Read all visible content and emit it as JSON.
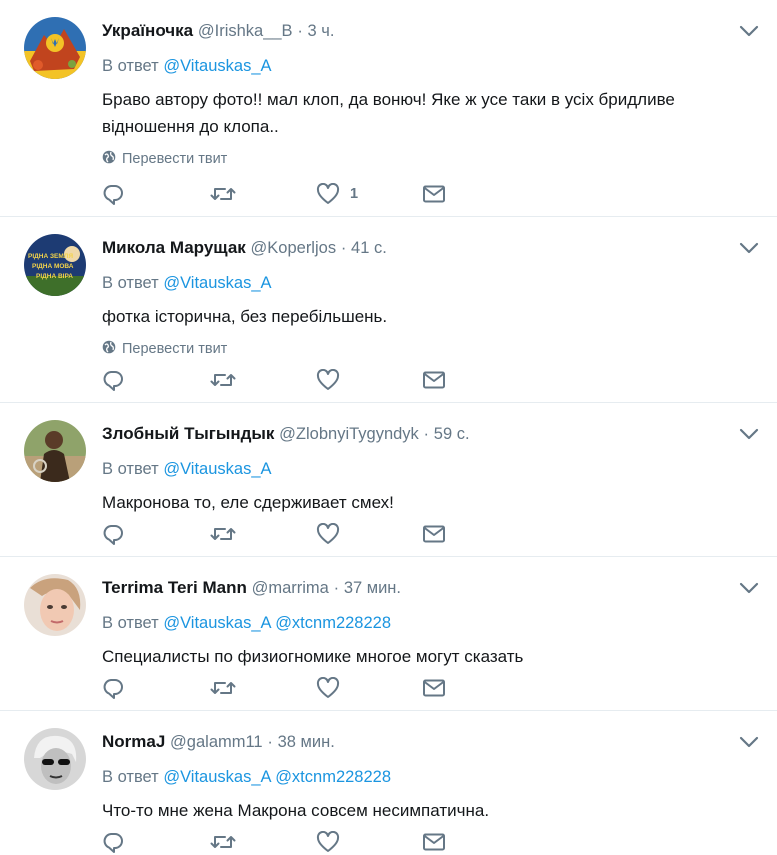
{
  "tweets": [
    {
      "name": "Україночка",
      "handle": "@Irishka__B",
      "sep": "·",
      "time": "3 ч.",
      "reply_prefix": "В ответ",
      "mentions": [
        "@Vitauskas_A"
      ],
      "text": "Браво автору фото!! мал клоп, да вонюч! Яке ж усе таки в усіх бридливе відношення до клопа..",
      "translate": "Перевести твит",
      "like_count": "1"
    },
    {
      "name": "Микола Марущак",
      "handle": "@Koperljos",
      "sep": "·",
      "time": "41 с.",
      "reply_prefix": "В ответ",
      "mentions": [
        "@Vitauskas_A"
      ],
      "text": "фотка історична, без перебільшень.",
      "translate": "Перевести твит",
      "like_count": "",
      "avatar_text": [
        "РІДНА ЗЕМЛЯ",
        "РІДНА МОВА",
        "РІДНА ВІРА"
      ]
    },
    {
      "name": "Злобный Тыгындык",
      "handle": "@ZlobnyiTygyndyk",
      "sep": "·",
      "time": "59 с.",
      "reply_prefix": "В ответ",
      "mentions": [
        "@Vitauskas_A"
      ],
      "text": "Макронова то, еле сдерживает смех!",
      "translate": "",
      "like_count": ""
    },
    {
      "name": "Terrima Teri Mann",
      "handle": "@marrima",
      "sep": "·",
      "time": "37 мин.",
      "reply_prefix": "В ответ",
      "mentions": [
        "@Vitauskas_A",
        "@xtcnm228228"
      ],
      "text": "Специалисты по физиогномике многое могут сказать",
      "translate": "",
      "like_count": ""
    },
    {
      "name": "NormaJ",
      "handle": "@galamm11",
      "sep": "·",
      "time": "38 мин.",
      "reply_prefix": "В ответ",
      "mentions": [
        "@Vitauskas_A",
        "@xtcnm228228"
      ],
      "text": "Что-то мне жена Макрона совсем несимпатична.",
      "translate": "",
      "like_count": ""
    }
  ],
  "icons": {
    "reply": "reply-icon",
    "retweet": "retweet-icon",
    "like": "heart-icon",
    "dm": "envelope-icon",
    "caret": "chevron-down-icon",
    "globe": "globe-icon"
  },
  "colors": {
    "link": "#1b95e0",
    "secondary": "#657786",
    "icon": "#657786",
    "divider": "#e6ecf0"
  }
}
